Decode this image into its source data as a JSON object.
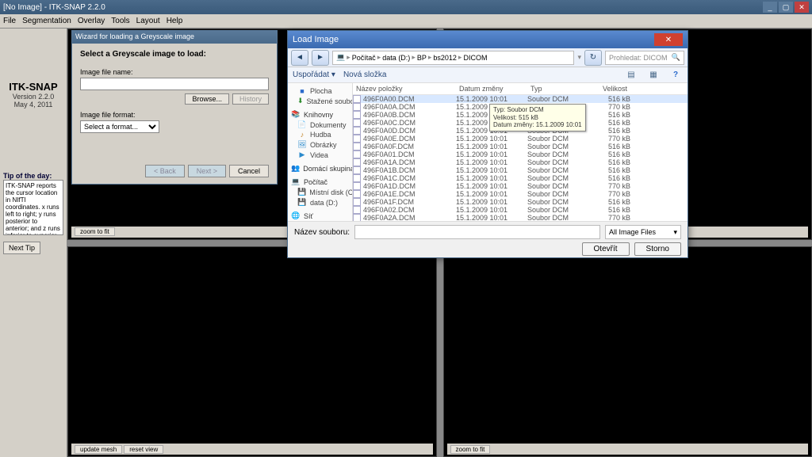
{
  "window": {
    "title": "[No Image] - ITK-SNAP 2.2.0",
    "min": "_",
    "max": "▢",
    "close": "✕"
  },
  "menu": [
    "File",
    "Segmentation",
    "Overlay",
    "Tools",
    "Layout",
    "Help"
  ],
  "sidebar": {
    "app": "ITK-SNAP",
    "version": "Version 2.2.0",
    "date": "May 4, 2011",
    "tip_title": "Tip of the day:",
    "tip_text": "ITK-SNAP reports the cursor location in NIfTI coordinates. x runs left to right; y runs posterior to anterior; and z runs inferior to superior.",
    "next_tip": "Next Tip"
  },
  "wizard": {
    "title": "Wizard for loading a Greyscale image",
    "heading": "Select a Greyscale image to load:",
    "fn_label": "Image file name:",
    "fn_value": "",
    "browse": "Browse...",
    "history": "History",
    "fmt_label": "Image file format:",
    "fmt_value": "Select a format...",
    "back": "< Back",
    "next": "Next >",
    "cancel": "Cancel"
  },
  "filedlg": {
    "title": "Load Image",
    "crumbs": [
      "Počítač",
      "data (D:)",
      "BP",
      "bs2012",
      "DICOM"
    ],
    "search_placeholder": "Prohledat: DICOM",
    "organize": "Uspořádat ▾",
    "newfolder": "Nová složka",
    "places": [
      {
        "icon": "■",
        "label": "Plocha",
        "cls": "child",
        "color": "#2a6acc"
      },
      {
        "icon": "⬇",
        "label": "Stažené soubory",
        "cls": "child",
        "color": "#2a8a2a"
      },
      {
        "icon": "📚",
        "label": "Knihovny",
        "cls": "group",
        "color": "#c08020"
      },
      {
        "icon": "📄",
        "label": "Dokumenty",
        "cls": "child",
        "color": "#c08020"
      },
      {
        "icon": "♪",
        "label": "Hudba",
        "cls": "child",
        "color": "#c08020"
      },
      {
        "icon": "🖼",
        "label": "Obrázky",
        "cls": "child",
        "color": "#2a8acc"
      },
      {
        "icon": "▶",
        "label": "Videa",
        "cls": "child",
        "color": "#2a8acc"
      },
      {
        "icon": "👥",
        "label": "Domácí skupina",
        "cls": "group",
        "color": "#2a8acc"
      },
      {
        "icon": "💻",
        "label": "Počítač",
        "cls": "group",
        "color": "#666"
      },
      {
        "icon": "💾",
        "label": "Místní disk (C:)",
        "cls": "child",
        "color": "#888"
      },
      {
        "icon": "💾",
        "label": "data (D:)",
        "cls": "child",
        "color": "#888"
      },
      {
        "icon": "🌐",
        "label": "Síť",
        "cls": "group",
        "color": "#2a8acc"
      }
    ],
    "cols": {
      "name": "Název položky",
      "date": "Datum změny",
      "type": "Typ",
      "size": "Velikost"
    },
    "rows": [
      {
        "name": "496F0A00.DCM",
        "date": "15.1.2009 10:01",
        "type": "Soubor DCM",
        "size": "516 kB",
        "sel": true
      },
      {
        "name": "496F0A0A.DCM",
        "date": "15.1.2009 10:01",
        "type": "Soubor DCM",
        "size": "770 kB"
      },
      {
        "name": "496F0A0B.DCM",
        "date": "15.1.2009 10:01",
        "type": "Soubor DCM",
        "size": "516 kB"
      },
      {
        "name": "496F0A0C.DCM",
        "date": "15.1.2009 10:01",
        "type": "Soubor DCM",
        "size": "516 kB"
      },
      {
        "name": "496F0A0D.DCM",
        "date": "15.1.2009 10:01",
        "type": "Soubor DCM",
        "size": "516 kB"
      },
      {
        "name": "496F0A0E.DCM",
        "date": "15.1.2009 10:01",
        "type": "Soubor DCM",
        "size": "770 kB"
      },
      {
        "name": "496F0A0F.DCM",
        "date": "15.1.2009 10:01",
        "type": "Soubor DCM",
        "size": "516 kB"
      },
      {
        "name": "496F0A01.DCM",
        "date": "15.1.2009 10:01",
        "type": "Soubor DCM",
        "size": "516 kB"
      },
      {
        "name": "496F0A1A.DCM",
        "date": "15.1.2009 10:01",
        "type": "Soubor DCM",
        "size": "516 kB"
      },
      {
        "name": "496F0A1B.DCM",
        "date": "15.1.2009 10:01",
        "type": "Soubor DCM",
        "size": "516 kB"
      },
      {
        "name": "496F0A1C.DCM",
        "date": "15.1.2009 10:01",
        "type": "Soubor DCM",
        "size": "516 kB"
      },
      {
        "name": "496F0A1D.DCM",
        "date": "15.1.2009 10:01",
        "type": "Soubor DCM",
        "size": "770 kB"
      },
      {
        "name": "496F0A1E.DCM",
        "date": "15.1.2009 10:01",
        "type": "Soubor DCM",
        "size": "770 kB"
      },
      {
        "name": "496F0A1F.DCM",
        "date": "15.1.2009 10:01",
        "type": "Soubor DCM",
        "size": "516 kB"
      },
      {
        "name": "496F0A02.DCM",
        "date": "15.1.2009 10:01",
        "type": "Soubor DCM",
        "size": "516 kB"
      },
      {
        "name": "496F0A2A.DCM",
        "date": "15.1.2009 10:01",
        "type": "Soubor DCM",
        "size": "770 kB"
      }
    ],
    "tooltip": {
      "l1": "Typ: Soubor DCM",
      "l2": "Velikost: 515 kB",
      "l3": "Datum změny: 15.1.2009 10:01"
    },
    "fn_label": "Název souboru:",
    "filter": "All Image Files",
    "open": "Otevřít",
    "cancel": "Storno"
  }
}
